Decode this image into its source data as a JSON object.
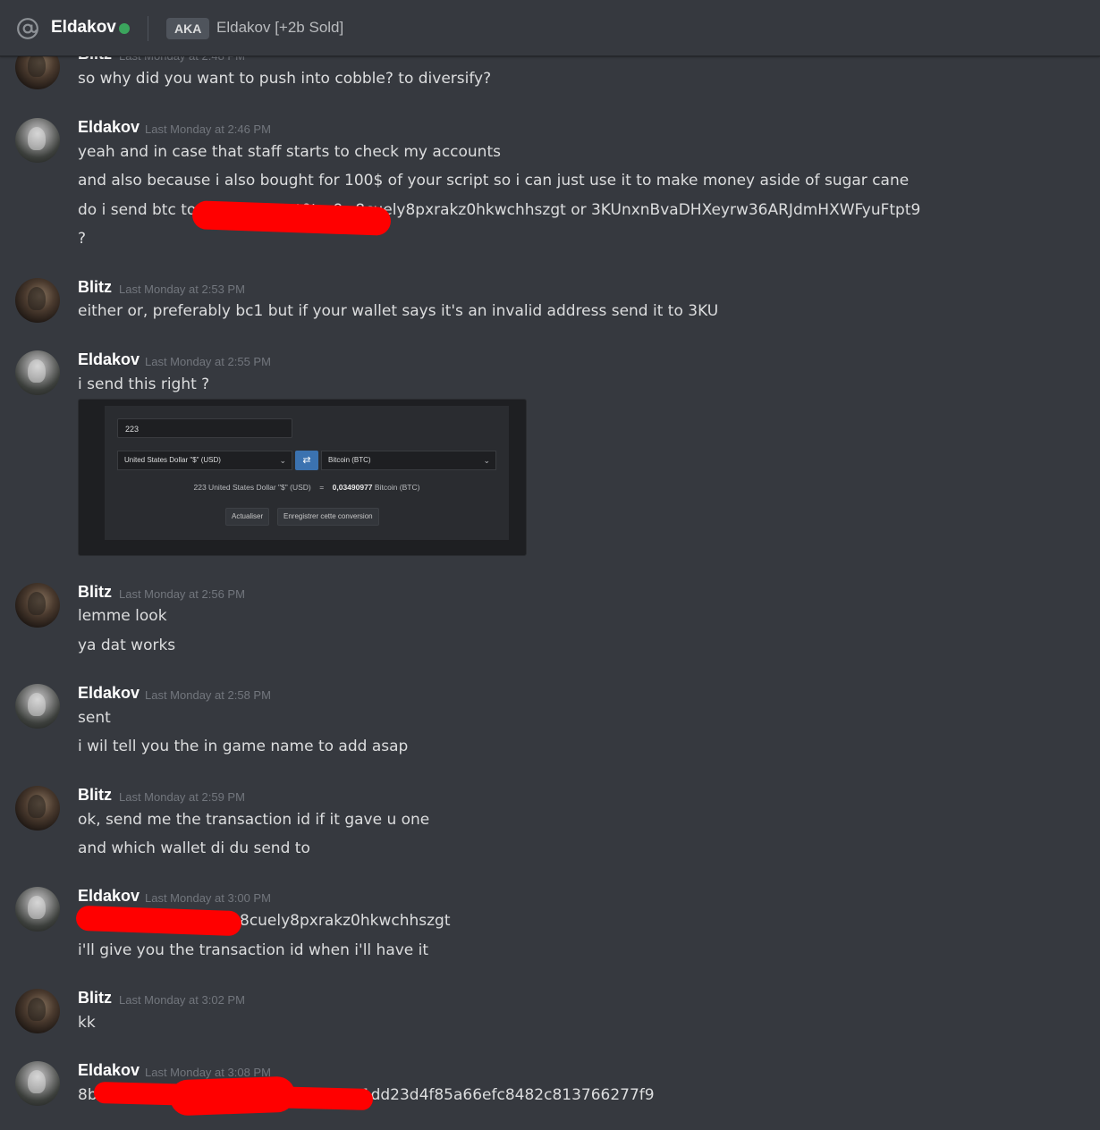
{
  "header": {
    "name": "Eldakov",
    "aka_label": "AKA",
    "alias": "Eldakov [+2b Sold]",
    "status_color": "#3ba55d"
  },
  "partial_top": {
    "author": "Blitz",
    "timestamp": "Last Monday at 2:48 PM",
    "line": "so why did you want to push into cobble? to diversify?"
  },
  "messages": [
    {
      "author": "Eldakov",
      "timestamp": "Last Monday at 2:46 PM",
      "lines": [
        "yeah and in case that staff starts to check my accounts",
        "and also because i also bought for 100$ of your script so i can just use it to make money aside of sugar cane",
        "do i send btc to bc1q7...6tpst0tzz9w8cuely8pxrakz0hkwchhszgt or 3KUnxnBvaDHXeyrw36ARJdmHXWFyuFtpt9",
        "?"
      ]
    },
    {
      "author": "Blitz",
      "timestamp": "Last Monday at 2:53 PM",
      "lines": [
        "either or, preferably bc1 but if your wallet says it's an invalid address send it to 3KU"
      ]
    },
    {
      "author": "Eldakov",
      "timestamp": "Last Monday at 2:55 PM",
      "lines": [
        "i send this right ?"
      ],
      "attachment": {
        "amount": "223",
        "from_currency": "United States Dollar \"$\" (USD)",
        "to_currency": "Bitcoin (BTC)",
        "swap_icon": "swap-arrows-icon",
        "result_left": "223 United States Dollar \"$\" (USD)",
        "result_equals": "=",
        "result_value": "0,03490977",
        "result_unit": "Bitcoin (BTC)",
        "button_refresh": "Actualiser",
        "button_save": "Enregistrer cette conversion"
      }
    },
    {
      "author": "Blitz",
      "timestamp": "Last Monday at 2:56 PM",
      "lines": [
        "lemme look",
        "ya dat works"
      ]
    },
    {
      "author": "Eldakov",
      "timestamp": "Last Monday at 2:58 PM",
      "lines": [
        "sent",
        "i wil tell you the in game name to add asap"
      ]
    },
    {
      "author": "Blitz",
      "timestamp": "Last Monday at 2:59 PM",
      "lines": [
        "ok, send me the transaction id if it gave u one",
        "and which wallet di du send to"
      ]
    },
    {
      "author": "Eldakov",
      "timestamp": "Last Monday at 3:00 PM",
      "lines": [
        "8cuely8pxrakz0hkwchhszgt",
        "i'll give you the transaction id when i'll have it"
      ]
    },
    {
      "author": "Blitz",
      "timestamp": "Last Monday at 3:02 PM",
      "lines": [
        "kk"
      ]
    },
    {
      "author": "Eldakov",
      "timestamp": "Last Monday at 3:08 PM",
      "lines": [
        "8b",
        "f",
        "222b68ae1dd23d4f85a66efc8482c813766277f9"
      ]
    }
  ],
  "colors": {
    "background": "#36393f",
    "text": "#dcddde",
    "username": "#ffffff",
    "timestamp": "#72767d",
    "redaction": "#ff0000",
    "swap_button": "#3b72b0"
  }
}
